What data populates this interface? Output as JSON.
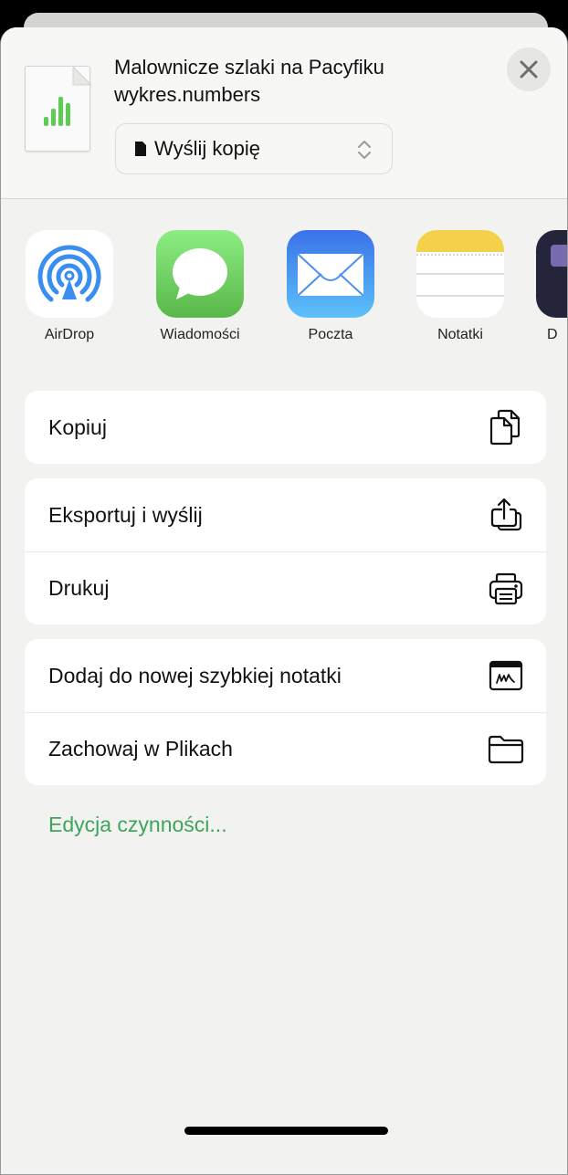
{
  "header": {
    "title": "Malownicze szlaki na Pacyfiku",
    "subtitle": "wykres.numbers",
    "thumbnail_icon": "numbers-chart-document-icon",
    "close_icon": "close-icon",
    "send_option": {
      "icon": "document-icon",
      "label": "Wyślij kopię",
      "chevron": "chevron-up-down-icon"
    }
  },
  "apps": [
    {
      "label": "AirDrop",
      "icon": "airdrop-icon"
    },
    {
      "label": "Wiadomości",
      "icon": "messages-icon"
    },
    {
      "label": "Poczta",
      "icon": "mail-icon"
    },
    {
      "label": "Notatki",
      "icon": "notes-icon"
    },
    {
      "label": "D",
      "icon": "partial-app-icon"
    }
  ],
  "actions": {
    "group1": [
      {
        "label": "Kopiuj",
        "icon": "copy-icon"
      }
    ],
    "group2": [
      {
        "label": "Eksportuj i wyślij",
        "icon": "export-share-icon"
      },
      {
        "label": "Drukuj",
        "icon": "printer-icon"
      }
    ],
    "group3": [
      {
        "label": "Dodaj do nowej szybkiej notatki",
        "icon": "quick-note-icon"
      },
      {
        "label": "Zachowaj w Plikach",
        "icon": "folder-icon"
      }
    ]
  },
  "edit_actions_label": "Edycja czynności...",
  "colors": {
    "accent_green": "#3fa55a",
    "airdrop_blue": "#3a8ef0",
    "messages_green": "#5ac85a",
    "mail_blue": "#3d8cf0",
    "notes_yellow": "#f5d04a"
  }
}
